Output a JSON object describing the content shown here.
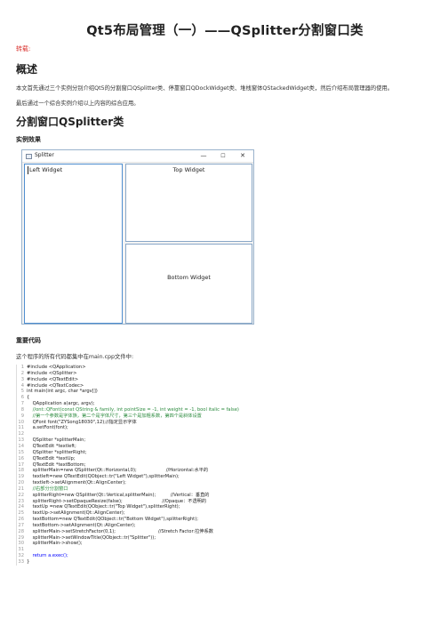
{
  "title": "Qt5布局管理（一）——QSplitter分割窗口类",
  "repost_label": "转载:",
  "section_overview": "概述",
  "overview_p1": "本文首先通过三个实例分别介绍Qt5的分割窗口QSplitter类、停靠窗口QDockWidget类、堆栈窗体QStackedWidget类，然后介绍布局管理器的使用。",
  "overview_p2": "最后通过一个综合实例介绍以上内容的综合应用。",
  "section_splitter": "分割窗口QSplitter类",
  "example_effect": "实例效果",
  "window": {
    "title": "Splitter",
    "min": "—",
    "max": "☐",
    "close": "✕",
    "left_widget": "Left Widget",
    "top_widget": "Top Widget",
    "bottom_widget": "Bottom Widget"
  },
  "important_code": "重要代码",
  "code_intro": "这个程序的所有代码都集中在main.cpp文件中:",
  "code_lines": [
    "#include <QApplication>",
    "#include <QSplitter>",
    "#include <QTextEdit>",
    "#include <QTextCodec>",
    "int main(int argc, char *argv[])",
    "{",
    "    QApplication a(argc, argv);",
    "    //ont::QFont(const QString & family, int pointSize = -1, int weight = -1, bool italic = false)",
    "    //第一个参数是字体族，第二个是字体尺寸，第三个是加粗系数，第四个是斜体设置",
    "    QFont font(\"ZYSong18030\",12);//指定显示字体",
    "    a.setFont(font);",
    "",
    "    QSplitter *splitterMain;",
    "    QTextEdit *textleft;",
    "    QSplitter *splitterRight;",
    "    QTextEdit *textUp;",
    "    QTextEdit *textBottom;",
    "    splitterMain=new QSplitter(Qt::Horizontal,0);                    //Horizontal:水平的",
    "    textleft=new QTextEdit(QObject::tr(\"Left Widget\"),splitterMain);",
    "    textleft->setAlignment(Qt::AlignCenter);",
    "    //右部分分割窗口",
    "    splitterRight=new QSplitter(Qt::Vertical,splitterMain);          //Vertical：垂直的",
    "    splitterRight->setOpaqueResize(false);                           //Opaque：不透明的",
    "    textUp =new QTextEdit(QObject::tr(\"Top Widget\"),splitterRight);",
    "    textUp->setAlignment(Qt::AlignCenter);",
    "    textBottom=new QTextEdit(QObject::tr(\"Bottom Widget\"),splitterRight);",
    "    textBottom->setAlignment(Qt::AlignCenter);",
    "    splitterMain->setStretchFactor(0,1);                             //Stretch Factor:拉伸系数",
    "    splitterMain->setWindowTitle(QObject::tr(\"Splitter\"));",
    "    splitterMain->show();",
    "",
    "    return a.exec();",
    "}"
  ]
}
